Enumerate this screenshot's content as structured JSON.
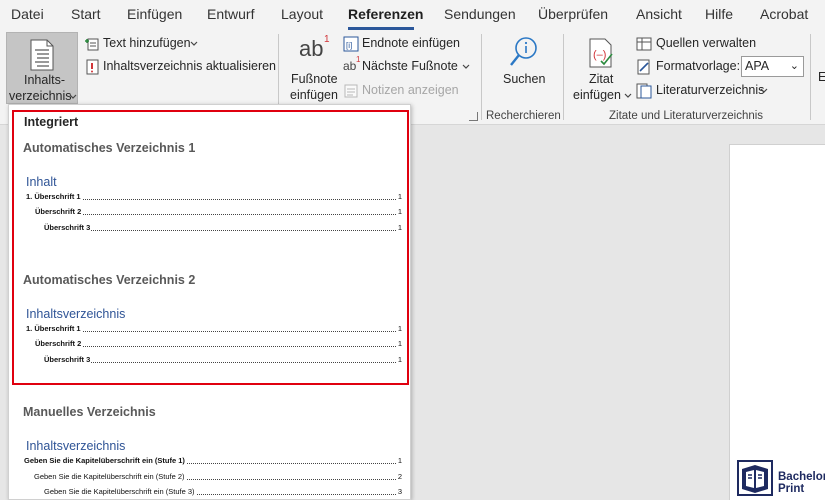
{
  "tabs": [
    "Datei",
    "Start",
    "Einfügen",
    "Entwurf",
    "Layout",
    "Referenzen",
    "Sendungen",
    "Überprüfen",
    "Ansicht",
    "Hilfe",
    "Acrobat"
  ],
  "active_tab": "Referenzen",
  "ribbon": {
    "toc": {
      "label_line1": "Inhalts-",
      "label_line2": "verzeichnis",
      "add_text": "Text hinzufügen",
      "update_toc": "Inhaltsverzeichnis aktualisieren"
    },
    "footnotes": {
      "insert_line1": "Fußnote",
      "insert_line2": "einfügen",
      "insert_endnote": "Endnote einfügen",
      "next_footnote": "Nächste Fußnote",
      "show_notes": "Notizen anzeigen"
    },
    "research": {
      "search": "Suchen",
      "group": "Recherchieren"
    },
    "citations": {
      "cite_line1": "Zitat",
      "cite_line2": "einfügen",
      "manage_sources": "Quellen verwalten",
      "style_label": "Formatvorlage:",
      "style_value": "APA",
      "bibliography": "Literaturverzeichnis",
      "group": "Zitate und Literaturverzeichnis"
    },
    "overflow_letter": "E"
  },
  "gallery": {
    "section_builtin": "Integriert",
    "auto1": {
      "name": "Automatisches Verzeichnis 1",
      "title": "Inhalt",
      "rows": [
        {
          "label": "1.      Überschrift 1",
          "page": "1"
        },
        {
          "label": "Überschrift 2",
          "page": "1"
        },
        {
          "label": "Überschrift 3",
          "page": "1"
        }
      ]
    },
    "auto2": {
      "name": "Automatisches Verzeichnis 2",
      "title": "Inhaltsverzeichnis",
      "rows": [
        {
          "label": "1.      Überschrift 1",
          "page": "1"
        },
        {
          "label": "Überschrift 2",
          "page": "1"
        },
        {
          "label": "Überschrift 3",
          "page": "1"
        }
      ]
    },
    "manual": {
      "name": "Manuelles Verzeichnis",
      "title": "Inhaltsverzeichnis",
      "rows": [
        {
          "label": "Geben Sie die Kapitelüberschrift ein (Stufe 1)",
          "page": "1"
        },
        {
          "label": "Geben Sie die Kapitelüberschrift ein (Stufe 2)",
          "page": "2"
        },
        {
          "label": "Geben Sie die Kapitelüberschrift ein (Stufe 3)",
          "page": "3"
        }
      ]
    }
  },
  "logo": {
    "line1": "Bachelor",
    "line2": "Print"
  },
  "colors": {
    "accent": "#2b579a",
    "highlight_frame": "#e0000f",
    "toc_title": "#2f5496"
  }
}
